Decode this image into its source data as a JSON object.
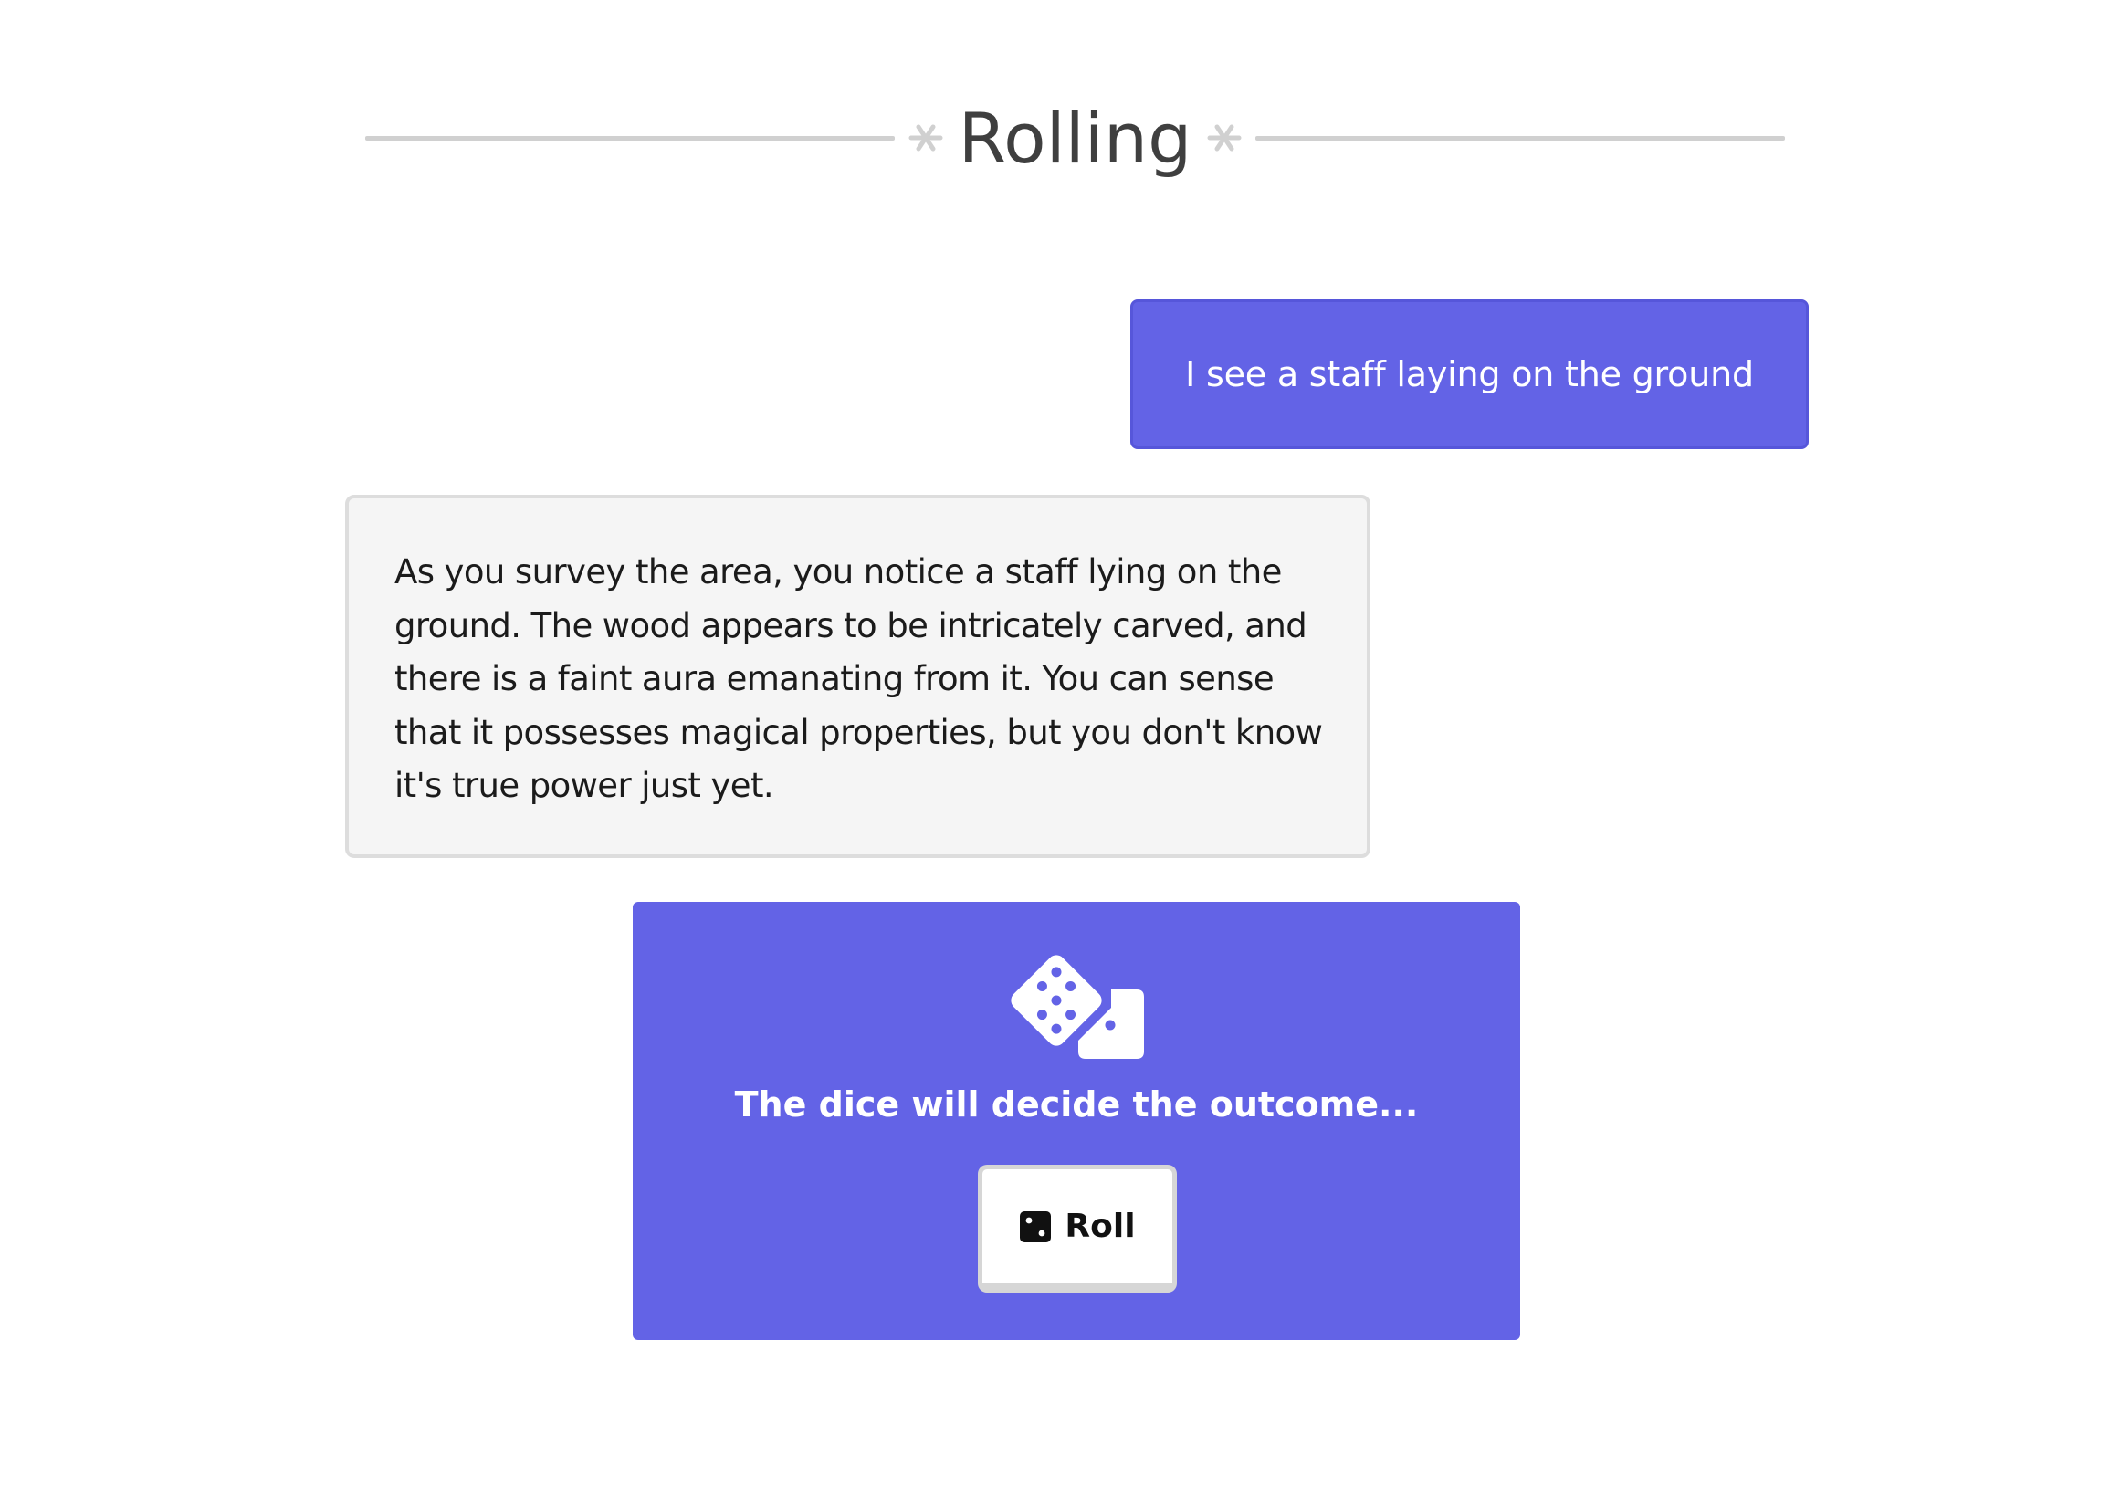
{
  "header": {
    "title": "Rolling"
  },
  "conversation": {
    "user_message": "I see a staff laying on the ground",
    "narrator_message": "As you survey the area, you notice a staff lying on the ground. The wood appears to be intricately carved, and there is a faint aura emanating from it. You can sense that it possesses magical properties, but you don't know it's true power just yet."
  },
  "dice_panel": {
    "icon": "dice-icon",
    "prompt": "The dice will decide the outcome...",
    "roll_button": {
      "icon": "die-icon",
      "label": "Roll"
    }
  },
  "colors": {
    "accent": "#6363e6",
    "narrator_bg": "#f5f5f5",
    "divider": "#d0d0d0",
    "title_text": "#3f3f3f"
  }
}
